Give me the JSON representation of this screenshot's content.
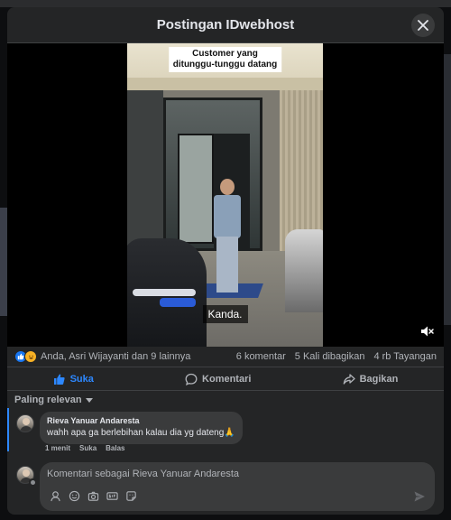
{
  "modal": {
    "title": "Postingan IDwebhost"
  },
  "video": {
    "overlay_caption_line1": "Customer yang",
    "overlay_caption_line2": "ditunggu-tunggu datang",
    "subtitle": "Kanda."
  },
  "stats": {
    "reactors": "Anda, Asri Wijayanti dan 9 lainnya",
    "comments": "6 komentar",
    "shares": "5 Kali dibagikan",
    "views": "4 rb Tayangan"
  },
  "actions": {
    "like": "Suka",
    "comment": "Komentari",
    "share": "Bagikan"
  },
  "sort": {
    "label": "Paling relevan"
  },
  "comment": {
    "author": "Rieva Yanuar Andaresta",
    "text": "wahh apa ga berlebihan kalau dia yg dateng🙏",
    "time": "1 menit",
    "like": "Suka",
    "reply": "Balas"
  },
  "composer": {
    "placeholder": "Komentari sebagai Rieva Yanuar Andaresta"
  },
  "colors": {
    "accent": "#2d88ff",
    "surface": "#242526",
    "bubble": "#3a3b3c"
  }
}
